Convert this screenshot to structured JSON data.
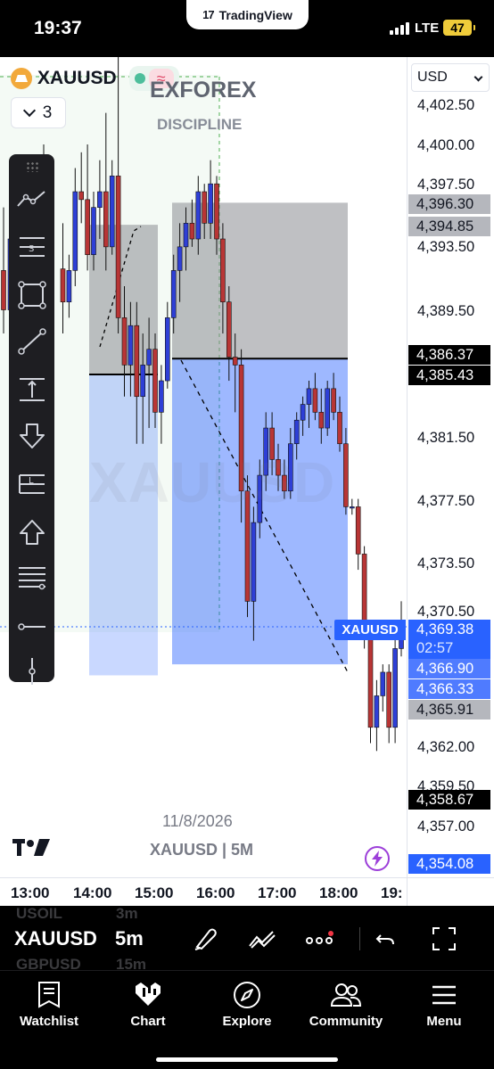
{
  "status_bar": {
    "time": "19:37",
    "app_pill": "TradingView",
    "network": "LTE",
    "battery": "47"
  },
  "chart": {
    "symbol": "XAUUSD",
    "interval": "3",
    "overlay_title": "EXFOREX",
    "overlay_subtitle": "DISCIPLINE",
    "watermark": "XAUUSD",
    "date_label": "11/8/2026",
    "symbol_timeframe": "XAUUSD | 5M",
    "price_tag_symbol": "XAUUSD",
    "colors": {
      "up": "#2e3fd6",
      "down": "#b83535",
      "long_zone": "#2962ff",
      "stop_zone": "#8b8d92"
    }
  },
  "price_axis": {
    "currency": "USD",
    "ticks": [
      "4,402.50",
      "4,400.00",
      "4,397.50",
      "4,393.50",
      "4,389.50",
      "4,381.50",
      "4,377.50",
      "4,373.50",
      "4,370.50",
      "4,362.00",
      "4,359.50",
      "4,357.00"
    ],
    "badges": {
      "b1": "4,396.30",
      "b2": "4,394.85",
      "b3": "4,386.37",
      "b4": "4,385.43",
      "last_price": "4,369.38",
      "countdown": "02:57",
      "b6": "4,366.90",
      "b7": "4,366.33",
      "b8": "4,365.91",
      "b9": "4,358.67",
      "b10": "4,354.08"
    }
  },
  "time_axis": {
    "ticks": [
      "13:00",
      "14:00",
      "15:00",
      "16:00",
      "17:00",
      "18:00",
      "19:"
    ]
  },
  "bottom_toolbar": {
    "symbol": "XAUUSD",
    "timeframe": "5m",
    "ghost_symbol_1": "USOIL",
    "ghost_tf_1": "3m",
    "ghost_symbol_2": "GBPUSD",
    "ghost_tf_2": "15m"
  },
  "tabs": [
    {
      "label": "Watchlist",
      "icon": "watchlist-icon"
    },
    {
      "label": "Chart",
      "icon": "chart-icon"
    },
    {
      "label": "Explore",
      "icon": "compass-icon"
    },
    {
      "label": "Community",
      "icon": "community-icon"
    },
    {
      "label": "Menu",
      "icon": "menu-icon"
    }
  ],
  "chart_data": {
    "type": "candlestick",
    "symbol": "XAUUSD",
    "timeframe": "5m",
    "y_range": [
      4354,
      4404
    ],
    "x_ticks": [
      "13:00",
      "14:00",
      "15:00",
      "16:00",
      "17:00",
      "18:00",
      "19:"
    ],
    "candles": [
      [
        4392.1,
        4395.0,
        4388.0,
        4390.0
      ],
      [
        4390.0,
        4393.0,
        4389.0,
        4392.0
      ],
      [
        4392.0,
        4398.5,
        4391.0,
        4397.0
      ],
      [
        4397.0,
        4399.5,
        4395.0,
        4396.5
      ],
      [
        4396.5,
        4400.0,
        4392.0,
        4393.0
      ],
      [
        4393.0,
        4397.0,
        4392.0,
        4396.0
      ],
      [
        4396.0,
        4399.0,
        4394.0,
        4397.0
      ],
      [
        4397.0,
        4402.0,
        4392.0,
        4393.5
      ],
      [
        4393.5,
        4399.0,
        4393.0,
        4398.0
      ],
      [
        4398.0,
        4406.0,
        4388.0,
        4389.0
      ],
      [
        4389.0,
        4391.0,
        4384.0,
        4386.0
      ],
      [
        4386.0,
        4390.0,
        4384.0,
        4388.5
      ],
      [
        4388.5,
        4390.0,
        4381.0,
        4384.0
      ],
      [
        4384.0,
        4388.0,
        4381.0,
        4386.0
      ],
      [
        4386.0,
        4389.0,
        4382.0,
        4387.0
      ],
      [
        4387.0,
        4388.0,
        4382.0,
        4383.0
      ],
      [
        4383.0,
        4386.0,
        4381.0,
        4385.0
      ],
      [
        4385.0,
        4390.0,
        4384.5,
        4389.0
      ],
      [
        4389.0,
        4393.0,
        4388.0,
        4392.0
      ],
      [
        4392.0,
        4395.0,
        4390.0,
        4393.5
      ],
      [
        4393.5,
        4396.0,
        4392.0,
        4395.0
      ],
      [
        4395.0,
        4396.5,
        4393.5,
        4394.0
      ],
      [
        4394.0,
        4398.0,
        4393.0,
        4397.0
      ],
      [
        4397.0,
        4397.5,
        4394.0,
        4395.0
      ],
      [
        4395.0,
        4399.0,
        4394.0,
        4397.5
      ],
      [
        4397.5,
        4398.0,
        4393.0,
        4394.0
      ],
      [
        4394.0,
        4395.0,
        4388.0,
        4390.0
      ],
      [
        4390.0,
        4391.0,
        4385.0,
        4386.5
      ],
      [
        4386.5,
        4388.0,
        4383.0,
        4386.0
      ],
      [
        4386.0,
        4387.0,
        4376.0,
        4378.0
      ],
      [
        4378.0,
        4379.0,
        4370.0,
        4371.0
      ],
      [
        4371.0,
        4377.0,
        4368.5,
        4376.0
      ],
      [
        4376.0,
        4380.0,
        4375.0,
        4379.0
      ],
      [
        4379.0,
        4383.0,
        4378.0,
        4382.0
      ],
      [
        4382.0,
        4383.0,
        4379.0,
        4380.0
      ],
      [
        4380.0,
        4381.0,
        4378.0,
        4379.0
      ],
      [
        4379.0,
        4380.0,
        4377.5,
        4378.0
      ],
      [
        4378.0,
        4382.0,
        4377.5,
        4381.0
      ],
      [
        4381.0,
        4383.0,
        4380.0,
        4382.5
      ],
      [
        4382.5,
        4384.0,
        4381.5,
        4383.5
      ],
      [
        4383.5,
        4385.0,
        4382.0,
        4384.5
      ],
      [
        4384.5,
        4385.5,
        4382.5,
        4383.0
      ],
      [
        4383.0,
        4384.5,
        4381.0,
        4382.0
      ],
      [
        4382.0,
        4385.0,
        4381.5,
        4384.5
      ],
      [
        4384.5,
        4385.5,
        4382.5,
        4383.0
      ],
      [
        4383.0,
        4384.0,
        4380.5,
        4381.0
      ],
      [
        4381.0,
        4382.0,
        4376.5,
        4377.0
      ],
      [
        4377.0,
        4377.5,
        4376.5,
        4377.0
      ],
      [
        4377.0,
        4377.5,
        4373.0,
        4374.0
      ],
      [
        4374.0,
        4374.5,
        4368.0,
        4369.0
      ],
      [
        4369.0,
        4369.5,
        4362.0,
        4363.0
      ],
      [
        4363.0,
        4366.0,
        4361.5,
        4365.0
      ],
      [
        4365.0,
        4367.0,
        4364.0,
        4366.5
      ],
      [
        4366.5,
        4367.0,
        4362.0,
        4363.0
      ],
      [
        4363.0,
        4369.0,
        4362.0,
        4368.0
      ],
      [
        4368.0,
        4371.0,
        4367.5,
        4369.4
      ]
    ],
    "positions": [
      {
        "type": "long",
        "entry": 4386.4,
        "stop": 4396.3,
        "target": 4367.0
      },
      {
        "type": "long",
        "entry": 4385.4,
        "stop": 4394.9,
        "target": 4366.3
      }
    ],
    "last_price": 4369.38
  }
}
